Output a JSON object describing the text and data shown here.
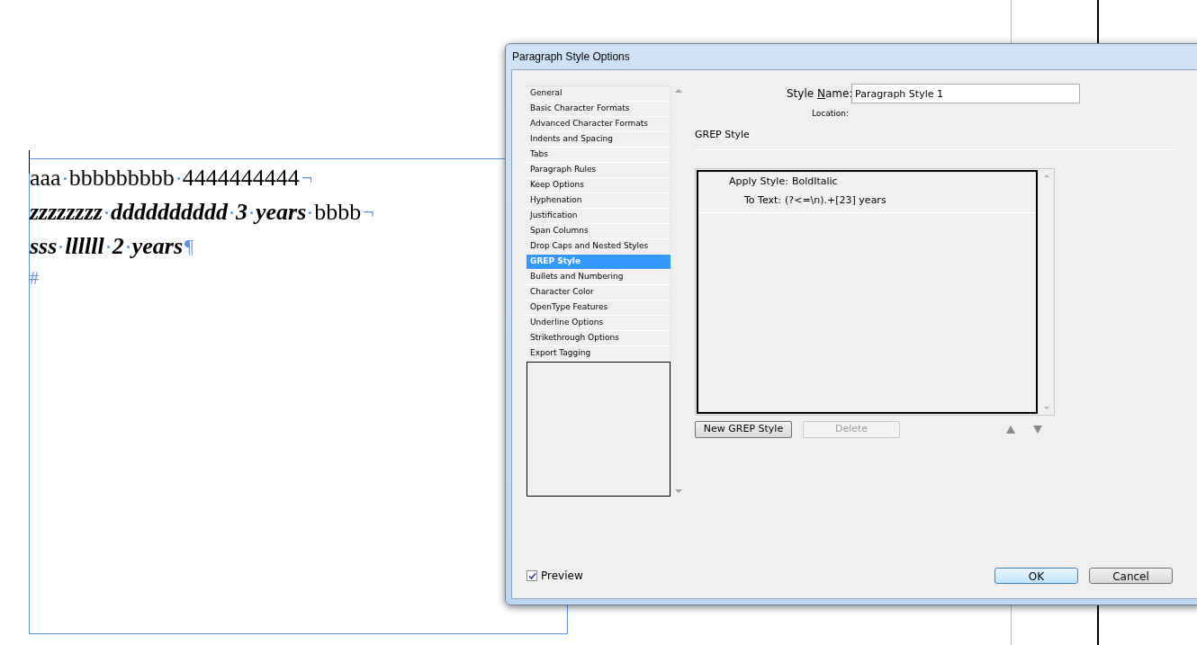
{
  "document": {
    "lines": [
      {
        "runs": [
          {
            "text": "aaa bbbbbbbbb 4444444444",
            "kind": "regular"
          }
        ],
        "end_mark": "¬"
      },
      {
        "runs": [
          {
            "text": "zzzzzzzz dddddddddd 3 years",
            "kind": "bolditalic"
          },
          {
            "text": "bbbb",
            "kind": "regular"
          }
        ],
        "end_mark": "¬"
      },
      {
        "runs": [
          {
            "text": "sss llllll 2 years",
            "kind": "bolditalic"
          }
        ],
        "end_mark": "¶"
      }
    ],
    "end_of_story": "#"
  },
  "dialog": {
    "title": "Paragraph Style Options",
    "categories": [
      {
        "label": "General",
        "selected": false
      },
      {
        "label": "Basic Character Formats",
        "selected": false
      },
      {
        "label": "Advanced Character Formats",
        "selected": false
      },
      {
        "label": "Indents and Spacing",
        "selected": false
      },
      {
        "label": "Tabs",
        "selected": false
      },
      {
        "label": "Paragraph Rules",
        "selected": false
      },
      {
        "label": "Keep Options",
        "selected": false
      },
      {
        "label": "Hyphenation",
        "selected": false
      },
      {
        "label": "Justification",
        "selected": false
      },
      {
        "label": "Span Columns",
        "selected": false
      },
      {
        "label": "Drop Caps and Nested Styles",
        "selected": false
      },
      {
        "label": "GREP Style",
        "selected": true
      },
      {
        "label": "Bullets and Numbering",
        "selected": false
      },
      {
        "label": "Character Color",
        "selected": false
      },
      {
        "label": "OpenType Features",
        "selected": false
      },
      {
        "label": "Underline Options",
        "selected": false
      },
      {
        "label": "Strikethrough Options",
        "selected": false
      },
      {
        "label": "Export Tagging",
        "selected": false
      }
    ],
    "style_name": {
      "label": "Style **N**ame:",
      "value": "Paragraph Style 1"
    },
    "location_label": "Location:",
    "section_title": "GREP Style",
    "grep_styles": [
      {
        "apply_label": "Apply Style:",
        "apply_value": "BoldItalic",
        "text_label": "To Text:",
        "text_value": "(?<=\\n).+[23] years"
      }
    ],
    "buttons": {
      "new": {
        "label": "New GREP Style",
        "disabled": false
      },
      "delete": {
        "label": "Delete",
        "disabled": true
      }
    },
    "preview": {
      "label": "Preview",
      "checked": true
    },
    "ok": "OK",
    "cancel": "Cancel"
  }
}
